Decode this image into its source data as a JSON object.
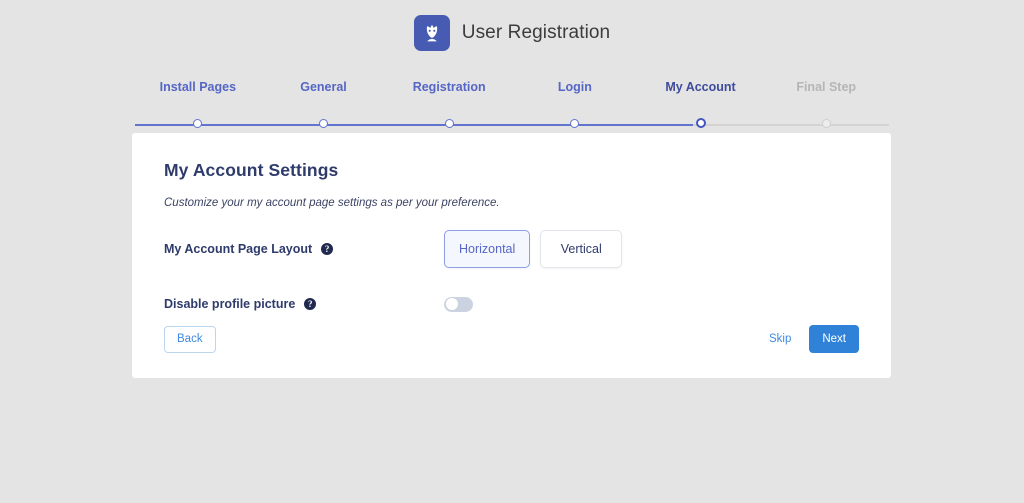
{
  "header": {
    "logo_icon": "user-registration-logo-icon",
    "title": "User Registration",
    "logo_color": "#475bb2"
  },
  "stepper": {
    "steps": [
      {
        "label": "Install Pages",
        "state": "done"
      },
      {
        "label": "General",
        "state": "done"
      },
      {
        "label": "Registration",
        "state": "done"
      },
      {
        "label": "Login",
        "state": "done"
      },
      {
        "label": "My Account",
        "state": "active"
      },
      {
        "label": "Final Step",
        "state": "inactive"
      }
    ],
    "active_color": "#4457bd",
    "done_color": "#6374cf",
    "inactive_color": "#b5b5b5"
  },
  "card": {
    "title": "My Account Settings",
    "subtitle": "Customize your my account page settings as per your preference.",
    "settings": [
      {
        "label": "My Account Page Layout",
        "help_icon": "help-circle-icon",
        "type": "choice",
        "options": [
          "Horizontal",
          "Vertical"
        ],
        "selected": "Horizontal"
      },
      {
        "label": "Disable profile picture",
        "help_icon": "help-circle-icon",
        "type": "toggle",
        "value": "off"
      }
    ],
    "footer": {
      "back_label": "Back",
      "skip_label": "Skip",
      "next_label": "Next",
      "next_color": "#3082d8"
    }
  }
}
